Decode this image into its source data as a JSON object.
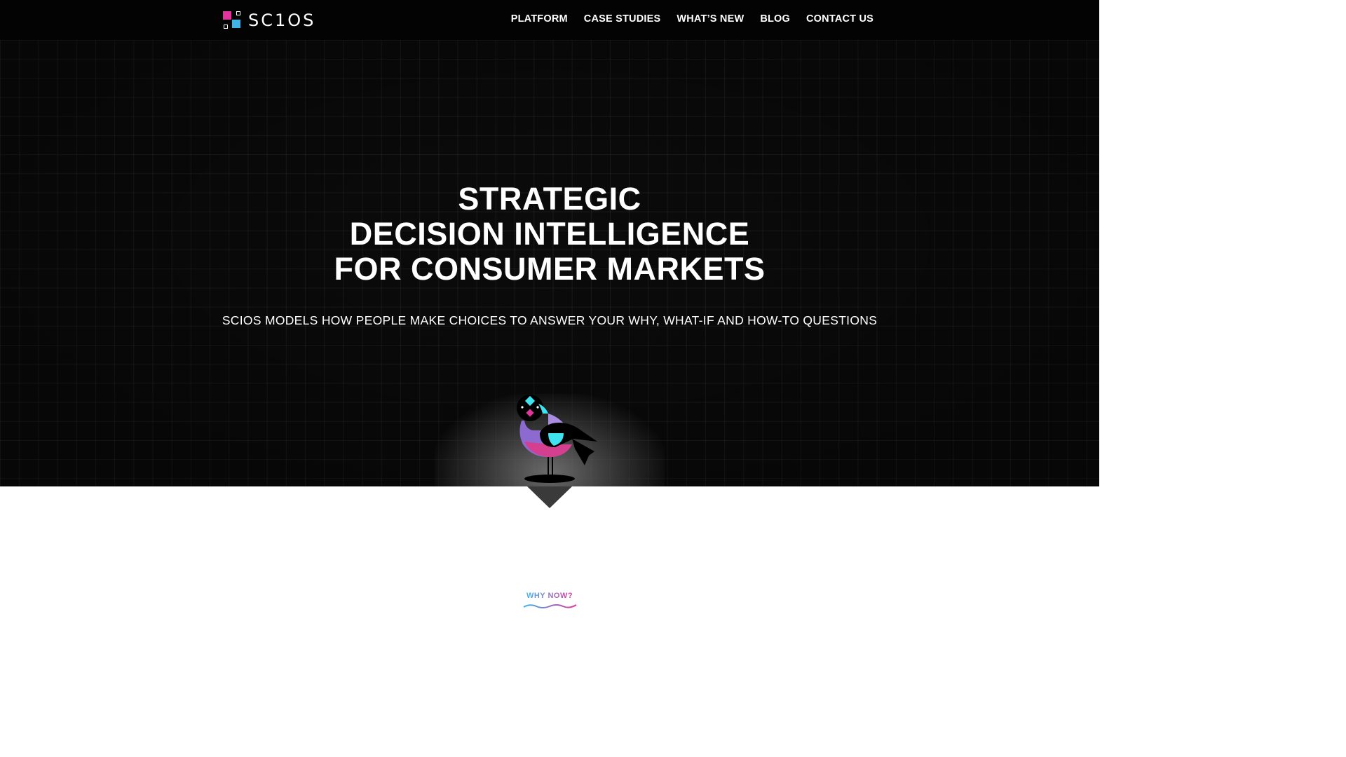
{
  "brand": {
    "name": "SC1OS",
    "colors": {
      "magenta": "#e0359c",
      "cyan": "#3fb4e8",
      "purple": "#9a6fd6"
    }
  },
  "nav": {
    "items": [
      {
        "label": "PLATFORM"
      },
      {
        "label": "CASE STUDIES"
      },
      {
        "label": "WHAT’S NEW"
      },
      {
        "label": "BLOG"
      },
      {
        "label": "CONTACT US"
      }
    ]
  },
  "hero": {
    "headline_lines": [
      "STRATEGIC",
      "DECISION INTELLIGENCE",
      "FOR CONSUMER MARKETS"
    ],
    "subhead": "SCIOS MODELS HOW PEOPLE MAKE CHOICES TO ANSWER YOUR WHY, WHAT-IF AND HOW-TO QUESTIONS",
    "illustration": "geometric-bird-icon"
  },
  "section": {
    "eyebrow": "WHY NOW?"
  }
}
